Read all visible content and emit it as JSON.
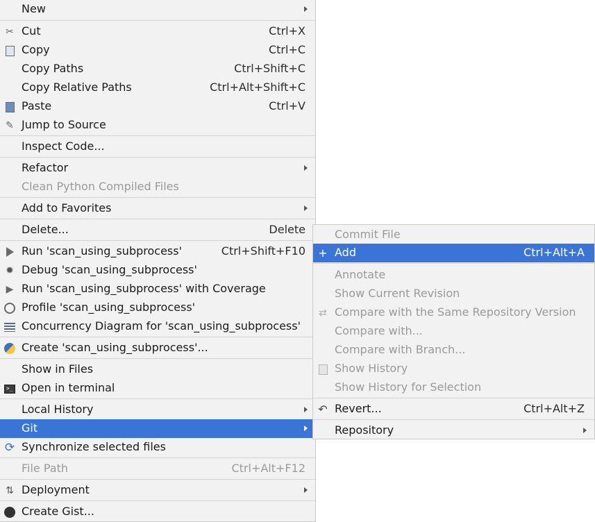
{
  "main_menu": {
    "items": [
      {
        "label": "New",
        "shortcut": "",
        "icon": "",
        "submenu": true
      },
      {
        "label": "Cut",
        "shortcut": "Ctrl+X",
        "icon": "scissors-icon"
      },
      {
        "label": "Copy",
        "shortcut": "Ctrl+C",
        "icon": "copy-icon"
      },
      {
        "label": "Copy Paths",
        "shortcut": "Ctrl+Shift+C",
        "icon": ""
      },
      {
        "label": "Copy Relative Paths",
        "shortcut": "Ctrl+Alt+Shift+C",
        "icon": ""
      },
      {
        "label": "Paste",
        "shortcut": "Ctrl+V",
        "icon": "paste-icon"
      },
      {
        "label": "Jump to Source",
        "shortcut": "",
        "icon": "jump-icon"
      },
      {
        "label": "Inspect Code...",
        "shortcut": "",
        "icon": ""
      },
      {
        "label": "Refactor",
        "shortcut": "",
        "icon": "",
        "submenu": true
      },
      {
        "label": "Clean Python Compiled Files",
        "shortcut": "",
        "icon": "",
        "disabled": true
      },
      {
        "label": "Add to Favorites",
        "shortcut": "",
        "icon": "",
        "submenu": true
      },
      {
        "label": "Delete...",
        "shortcut": "Delete",
        "icon": ""
      },
      {
        "label": "Run 'scan_using_subprocess'",
        "shortcut": "Ctrl+Shift+F10",
        "icon": "run-icon"
      },
      {
        "label": "Debug 'scan_using_subprocess'",
        "shortcut": "",
        "icon": "debug-icon"
      },
      {
        "label": "Run 'scan_using_subprocess' with Coverage",
        "shortcut": "",
        "icon": "coverage-icon"
      },
      {
        "label": "Profile 'scan_using_subprocess'",
        "shortcut": "",
        "icon": "profile-icon"
      },
      {
        "label": "Concurrency Diagram for 'scan_using_subprocess'",
        "shortcut": "",
        "icon": "concurrency-icon"
      },
      {
        "label": "Create 'scan_using_subprocess'...",
        "shortcut": "",
        "icon": "python-icon"
      },
      {
        "label": "Show in Files",
        "shortcut": "",
        "icon": ""
      },
      {
        "label": "Open in terminal",
        "shortcut": "",
        "icon": "terminal-icon"
      },
      {
        "label": "Local History",
        "shortcut": "",
        "icon": "",
        "submenu": true
      },
      {
        "label": "Git",
        "shortcut": "",
        "icon": "",
        "submenu": true,
        "selected": true
      },
      {
        "label": "Synchronize selected files",
        "shortcut": "",
        "icon": "sync-icon"
      },
      {
        "label": "File Path",
        "shortcut": "Ctrl+Alt+F12",
        "icon": "",
        "disabled": true
      },
      {
        "label": "Deployment",
        "shortcut": "",
        "icon": "deployment-icon",
        "submenu": true
      },
      {
        "label": "Create Gist...",
        "shortcut": "",
        "icon": "github-icon"
      }
    ]
  },
  "git_submenu": {
    "items": [
      {
        "label": "Commit File",
        "shortcut": "",
        "disabled": true
      },
      {
        "label": "Add",
        "shortcut": "Ctrl+Alt+A",
        "icon": "plus-icon",
        "selected": true
      },
      {
        "label": "Annotate",
        "shortcut": "",
        "disabled": true
      },
      {
        "label": "Show Current Revision",
        "shortcut": "",
        "disabled": true
      },
      {
        "label": "Compare with the Same Repository Version",
        "shortcut": "",
        "icon": "compare-icon",
        "disabled": true
      },
      {
        "label": "Compare with...",
        "shortcut": "",
        "disabled": true
      },
      {
        "label": "Compare with Branch...",
        "shortcut": "",
        "disabled": true
      },
      {
        "label": "Show History",
        "shortcut": "",
        "icon": "history-icon",
        "disabled": true
      },
      {
        "label": "Show History for Selection",
        "shortcut": "",
        "disabled": true
      },
      {
        "label": "Revert...",
        "shortcut": "Ctrl+Alt+Z",
        "icon": "revert-icon"
      },
      {
        "label": "Repository",
        "shortcut": "",
        "submenu": true
      }
    ]
  },
  "colors": {
    "selection": "#3a74d6",
    "menu_bg": "#f2f2f2",
    "disabled_text": "#9a9a9a"
  }
}
